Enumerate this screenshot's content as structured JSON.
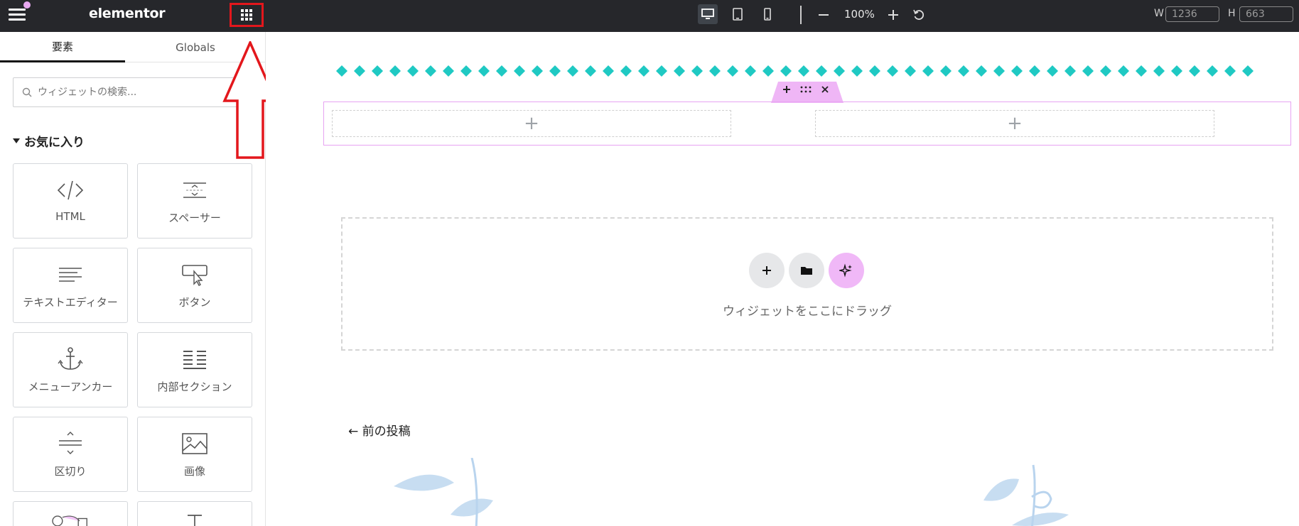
{
  "topbar": {
    "brand": "elementor",
    "zoom": "100%",
    "width_label": "W",
    "width_value": "1236",
    "height_label": "H",
    "height_value": "663",
    "accent_dot_color": "#e8a9f0",
    "highlight_color": "#e3171c"
  },
  "panel": {
    "tabs": [
      {
        "label": "要素",
        "active": true
      },
      {
        "label": "Globals",
        "active": false
      }
    ],
    "search_placeholder": "ウィジェットの検索...",
    "favorites_title": "お気に入り",
    "widgets": [
      {
        "label": "HTML",
        "icon": "code-icon"
      },
      {
        "label": "スペーサー",
        "icon": "spacer-icon"
      },
      {
        "label": "テキストエディター",
        "icon": "text-editor-icon"
      },
      {
        "label": "ボタン",
        "icon": "button-icon"
      },
      {
        "label": "メニューアンカー",
        "icon": "anchor-icon"
      },
      {
        "label": "内部セクション",
        "icon": "inner-section-icon"
      },
      {
        "label": "区切り",
        "icon": "divider-icon"
      },
      {
        "label": "画像",
        "icon": "image-icon"
      }
    ]
  },
  "canvas": {
    "diamond_color": "#1fc9c3",
    "section_border_color": "#e7a3f2",
    "dropzone_text": "ウィジェットをここにドラッグ",
    "prev_post": "← 前の投稿",
    "ai_button_color": "#f0b8f7"
  }
}
